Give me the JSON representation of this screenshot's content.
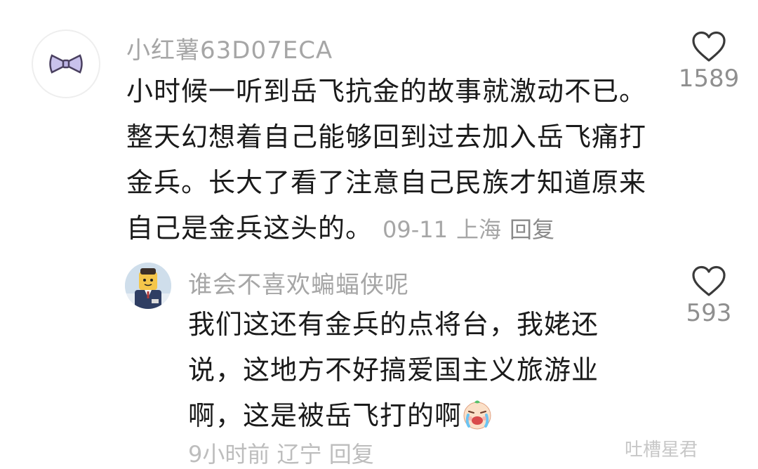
{
  "comments": [
    {
      "username": "小红薯63D07ECA",
      "avatar_icon": "bow-tie-icon",
      "lines": [
        "小时候一听到岳飞抗金的故事就激动不已。",
        "整天幻想着自己能够回到过去加入岳飞痛打",
        "金兵。长大了看了注意自己民族才知道原来",
        "自己是金兵这头的。"
      ],
      "date": "09-11",
      "location": "上海",
      "reply_label": "回复",
      "likes": "1589"
    },
    {
      "username": "谁会不喜欢蝙蝠侠呢",
      "avatar_icon": "lego-figure-avatar",
      "lines": [
        "我们这还有金兵的点将台，我姥还",
        "说，这地方不好搞爱国主义旅游业",
        "啊，这是被岳飞打的啊"
      ],
      "emoji": "crying-face-emoji",
      "likes": "593",
      "cut_meta": "9小时前 辽宁 回复"
    }
  ],
  "watermark": "吐槽星君",
  "colors": {
    "username": "#a6a6a6",
    "text": "#1a1a1a",
    "meta": "#a6a6a6",
    "like_count": "#8f8f8f",
    "heart_stroke": "#3a3a3a"
  }
}
